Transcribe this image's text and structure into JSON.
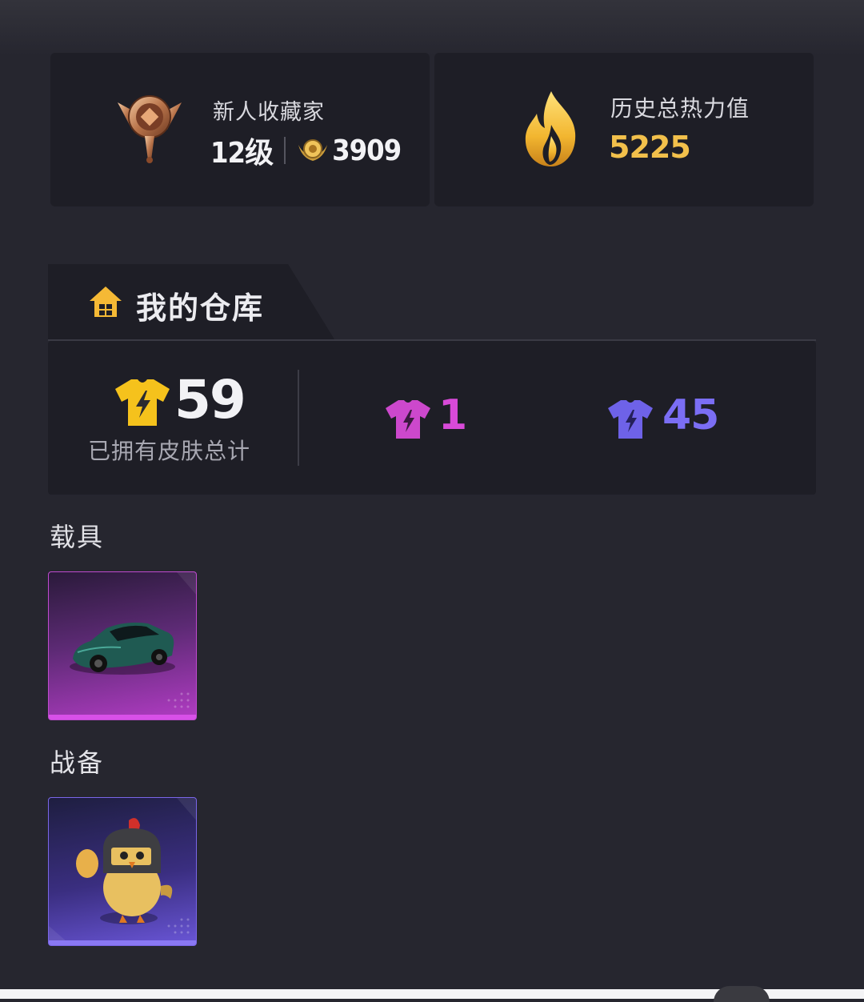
{
  "profile": {
    "rank_title": "新人收藏家",
    "level": "12级",
    "points": "3909"
  },
  "heat": {
    "title": "历史总热力值",
    "value": "5225"
  },
  "warehouse": {
    "title": "我的仓库",
    "total_count": "59",
    "total_label": "已拥有皮肤总计",
    "purple_count": "1",
    "blue_count": "45"
  },
  "sections": {
    "vehicles": "载具",
    "gear": "战备"
  },
  "colors": {
    "background": "#26262f",
    "card": "#1e1e26",
    "gold": "#f2c04b",
    "pink": "#d84ad8",
    "blue": "#7b6ef4"
  }
}
